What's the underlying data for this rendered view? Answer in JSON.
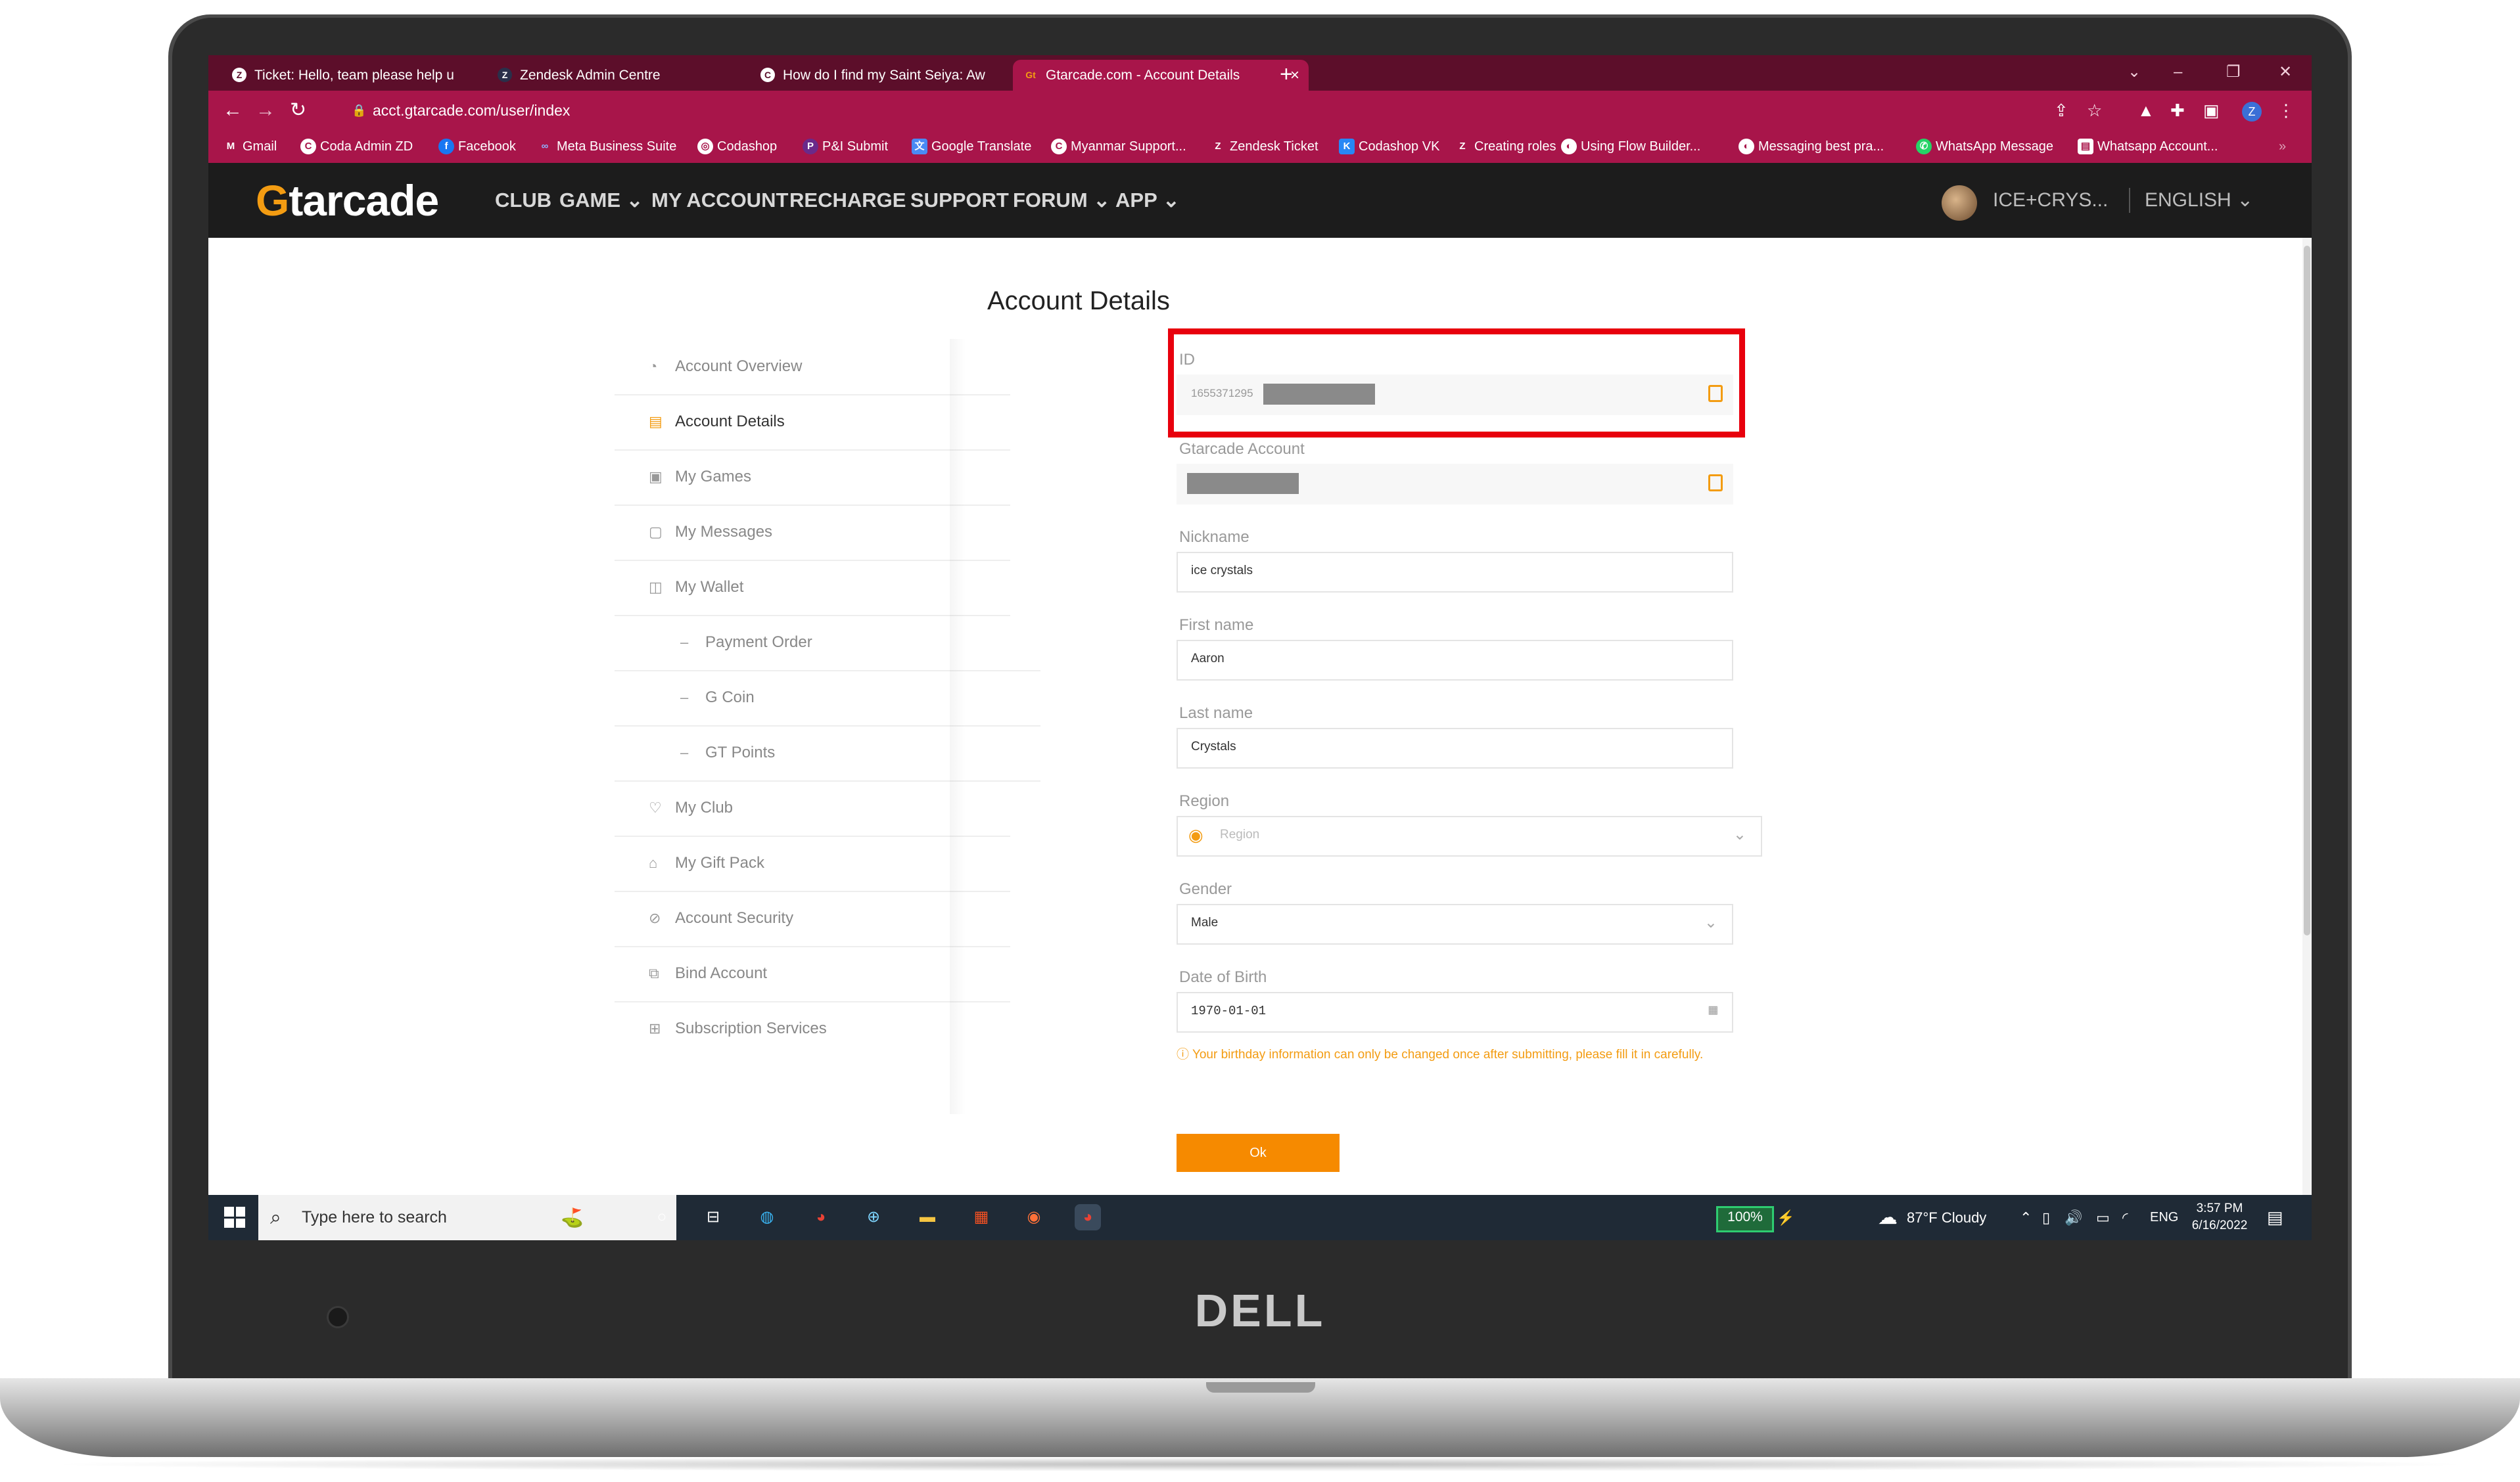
{
  "browser": {
    "tabs": [
      {
        "label": "Ticket: Hello, team please help u",
        "icon": "zendesk-icon"
      },
      {
        "label": "Zendesk Admin Centre",
        "icon": "zendesk-icon"
      },
      {
        "label": "How do I find my Saint Seiya: Aw",
        "icon": "coda-icon"
      },
      {
        "label": "Gtarcade.com - Account Details",
        "icon": "gtarcade-icon"
      }
    ],
    "new_tab_symbol": "+",
    "url": "acct.gtarcade.com/user/index",
    "profile_initial": "Z",
    "bookmarks": [
      "Gmail",
      "Coda Admin ZD",
      "Facebook",
      "Meta Business Suite",
      "Codashop",
      "P&I Submit",
      "Google Translate",
      "Myanmar Support...",
      "Zendesk Ticket",
      "Codashop VK",
      "Creating roles",
      "Using Flow Builder...",
      "Messaging best pra...",
      "WhatsApp Message",
      "Whatsapp Account..."
    ],
    "bookmarks_more": "»"
  },
  "site": {
    "logo_g": "G",
    "logo_rest": "tarcade",
    "menu": [
      "CLUB",
      "GAME",
      "MY ACCOUNT",
      "RECHARGE",
      "SUPPORT",
      "FORUM",
      "APP"
    ],
    "user_name": "ICE+CRYS...",
    "language": "ENGLISH"
  },
  "page": {
    "title": "Account Details",
    "side_menu": [
      {
        "label": "Account Overview",
        "icon": "account-overview-icon",
        "active": false,
        "sub": false
      },
      {
        "label": "Account Details",
        "icon": "account-details-icon",
        "active": true,
        "sub": false
      },
      {
        "label": "My Games",
        "icon": "games-icon",
        "active": false,
        "sub": false
      },
      {
        "label": "My Messages",
        "icon": "messages-icon",
        "active": false,
        "sub": false
      },
      {
        "label": "My Wallet",
        "icon": "wallet-icon",
        "active": false,
        "sub": false
      },
      {
        "label": "Payment Order",
        "icon": "dash-icon",
        "active": false,
        "sub": true
      },
      {
        "label": "G Coin",
        "icon": "dash-icon",
        "active": false,
        "sub": true
      },
      {
        "label": "GT Points",
        "icon": "dash-icon",
        "active": false,
        "sub": true
      },
      {
        "label": "My Club",
        "icon": "club-icon",
        "active": false,
        "sub": false
      },
      {
        "label": "My Gift Pack",
        "icon": "gift-icon",
        "active": false,
        "sub": false
      },
      {
        "label": "Account Security",
        "icon": "security-icon",
        "active": false,
        "sub": false
      },
      {
        "label": "Bind Account",
        "icon": "bind-icon",
        "active": false,
        "sub": false
      },
      {
        "label": "Subscription Services",
        "icon": "subscription-icon",
        "active": false,
        "sub": false
      }
    ],
    "form": {
      "id_label": "ID",
      "id_value": "1655371295",
      "account_label": "Gtarcade Account",
      "nickname_label": "Nickname",
      "nickname_value": "ice crystals",
      "first_name_label": "First name",
      "first_name_value": "Aaron",
      "last_name_label": "Last name",
      "last_name_value": "Crystals",
      "region_label": "Region",
      "region_placeholder": "Region",
      "gender_label": "Gender",
      "gender_value": "Male",
      "dob_label": "Date of Birth",
      "dob_value": "1970-01-01",
      "birthday_note": "Your birthday information can only be changed once after submitting, please fill it in carefully.",
      "ok_label": "Ok"
    },
    "highlight_color": "#e8000d",
    "accent_color": "#f68a00"
  },
  "taskbar": {
    "search_placeholder": "Type here to search",
    "battery": "100%",
    "weather": "87°F  Cloudy",
    "language": "ENG",
    "time": "3:57 PM",
    "date": "6/16/2022"
  },
  "device": {
    "brand": "DELL"
  }
}
